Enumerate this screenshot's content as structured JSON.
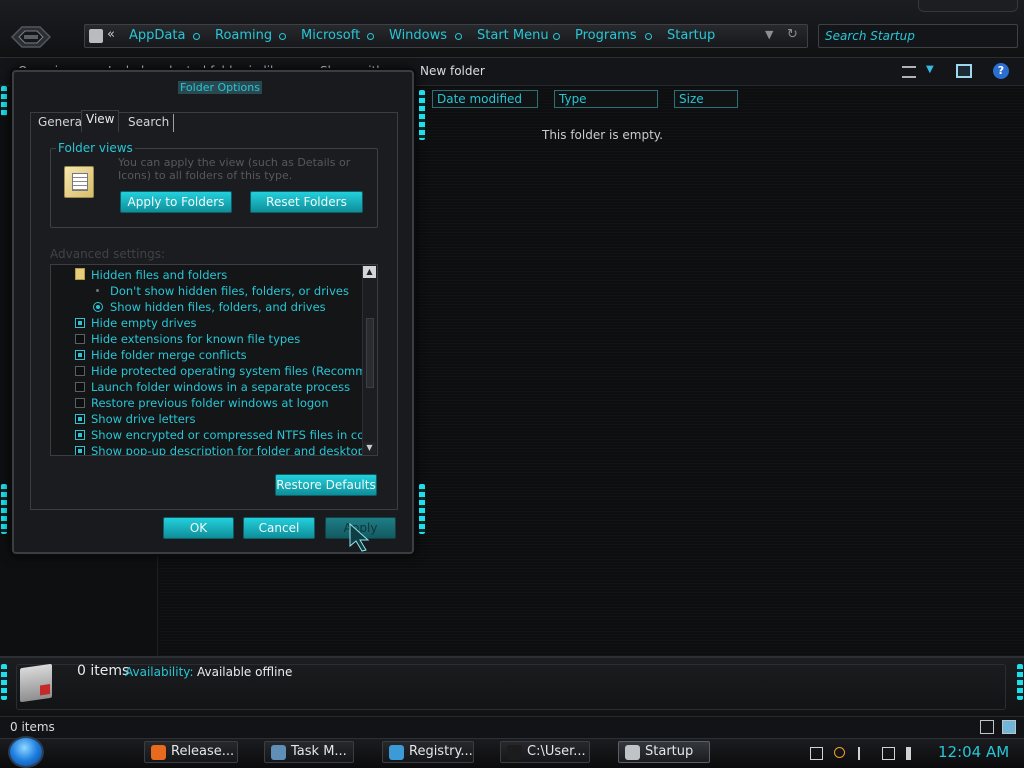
{
  "explorer": {
    "address": {
      "crumbs": [
        "AppData",
        "Roaming",
        "Microsoft",
        "Windows",
        "Start Menu",
        "Programs",
        "Startup"
      ],
      "chevrons": "«",
      "refresh_icon": "refresh-icon"
    },
    "search": {
      "placeholder": "Search Startup"
    },
    "toolbar": {
      "organize": "Organize ▾",
      "include": "Include selected folder in library ▾",
      "share": "Share with ▾",
      "new_folder": "New folder"
    },
    "columns": [
      "Date modified",
      "Type",
      "Size"
    ],
    "empty_message": "This folder is empty.",
    "details": {
      "count": "0 items",
      "availability_label": "Availability:",
      "availability_value": "Available offline"
    },
    "status": "0 items"
  },
  "dialog": {
    "title": "Folder Options",
    "tabs": [
      "General",
      "View",
      "Search"
    ],
    "active_tab": "View",
    "folder_views": {
      "legend": "Folder views",
      "description": "You can apply the view (such as Details or Icons) to all folders of this type.",
      "apply_label": "Apply to Folders",
      "reset_label": "Reset Folders"
    },
    "advanced_label": "Advanced settings:",
    "advanced": [
      {
        "label": "Hidden files and folders",
        "kind": "folder",
        "indent": 0,
        "checked": null
      },
      {
        "label": "Don't show hidden files, folders, or drives",
        "kind": "radio",
        "indent": 1,
        "checked": false
      },
      {
        "label": "Show hidden files, folders, and drives",
        "kind": "radio",
        "indent": 1,
        "checked": true
      },
      {
        "label": "Hide empty drives",
        "kind": "check",
        "indent": 0,
        "checked": true
      },
      {
        "label": "Hide extensions for known file types",
        "kind": "check",
        "indent": 0,
        "checked": false
      },
      {
        "label": "Hide folder merge conflicts",
        "kind": "check",
        "indent": 0,
        "checked": true
      },
      {
        "label": "Hide protected operating system files (Recommended)",
        "kind": "check",
        "indent": 0,
        "checked": false
      },
      {
        "label": "Launch folder windows in a separate process",
        "kind": "check",
        "indent": 0,
        "checked": false
      },
      {
        "label": "Restore previous folder windows at logon",
        "kind": "check",
        "indent": 0,
        "checked": false
      },
      {
        "label": "Show drive letters",
        "kind": "check",
        "indent": 0,
        "checked": true
      },
      {
        "label": "Show encrypted or compressed NTFS files in color",
        "kind": "check",
        "indent": 0,
        "checked": true
      },
      {
        "label": "Show pop-up description for folder and desktop items",
        "kind": "check",
        "indent": 0,
        "checked": true
      }
    ],
    "restore_defaults_label": "Restore Defaults",
    "ok_label": "OK",
    "cancel_label": "Cancel",
    "apply_label": "Apply"
  },
  "taskbar": {
    "tasks": [
      {
        "label": "Release...",
        "icon": "firefox-icon",
        "color": "#e86a1f"
      },
      {
        "label": "Task M...",
        "icon": "task-manager-icon",
        "color": "#5f8fb7"
      },
      {
        "label": "Registry...",
        "icon": "registry-icon",
        "color": "#3c9ad6"
      },
      {
        "label": "C:\\User...",
        "icon": "cmd-icon",
        "color": "#1c1c1c"
      },
      {
        "label": "Startup",
        "icon": "folder-icon",
        "color": "#bfc3c6"
      }
    ],
    "active_task": "Startup",
    "clock": "12:04 AM"
  },
  "colors": {
    "accent": "#27c6d6",
    "background": "#0c0c0e"
  }
}
